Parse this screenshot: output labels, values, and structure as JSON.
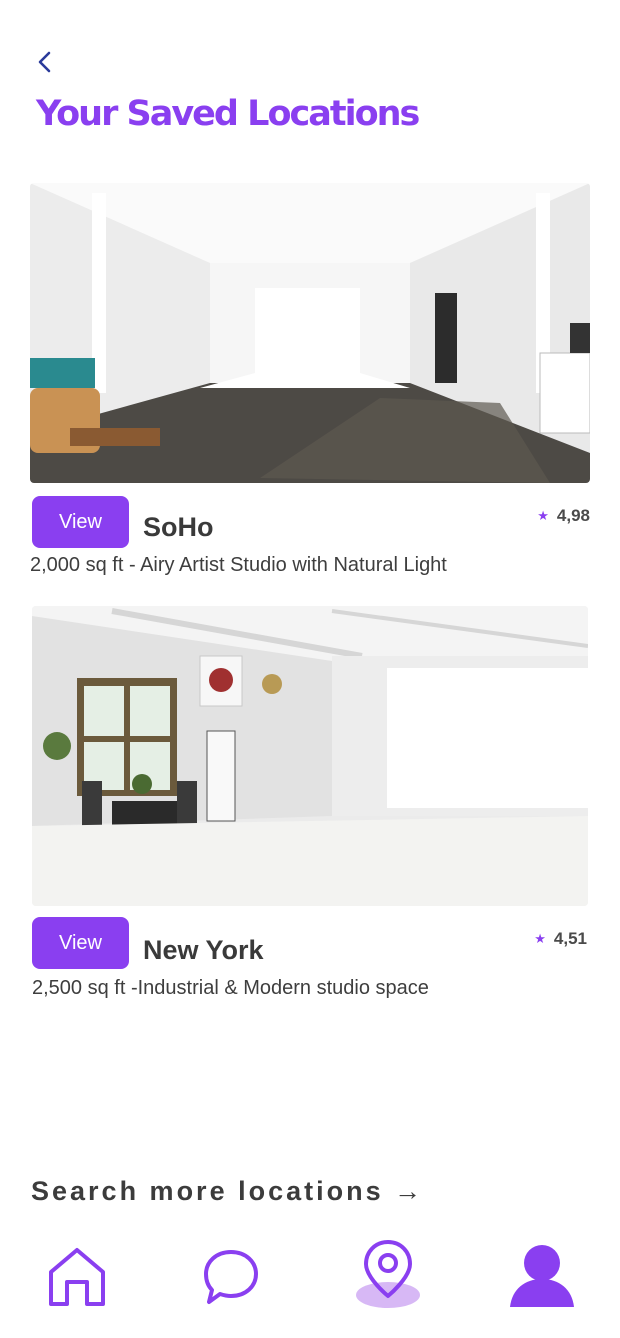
{
  "header": {
    "title": "Your Saved Locations"
  },
  "locations": [
    {
      "name": "SoHo",
      "rating": "4,98",
      "description": "2,000 sq ft - Airy Artist Studio with Natural Light",
      "view_label": "View"
    },
    {
      "name": "New York",
      "rating": "4,51",
      "description": "2,500 sq ft -Industrial & Modern studio space",
      "view_label": "View"
    }
  ],
  "search_more": {
    "label": "Search more locations →"
  },
  "nav": {
    "active": "map",
    "items": [
      "home-icon",
      "chat-icon",
      "map-pin-icon",
      "profile-icon"
    ]
  },
  "colors": {
    "accent": "#8a3ff0",
    "accent_light": "#d7b8f5",
    "back_arrow": "#2a3a9a"
  }
}
